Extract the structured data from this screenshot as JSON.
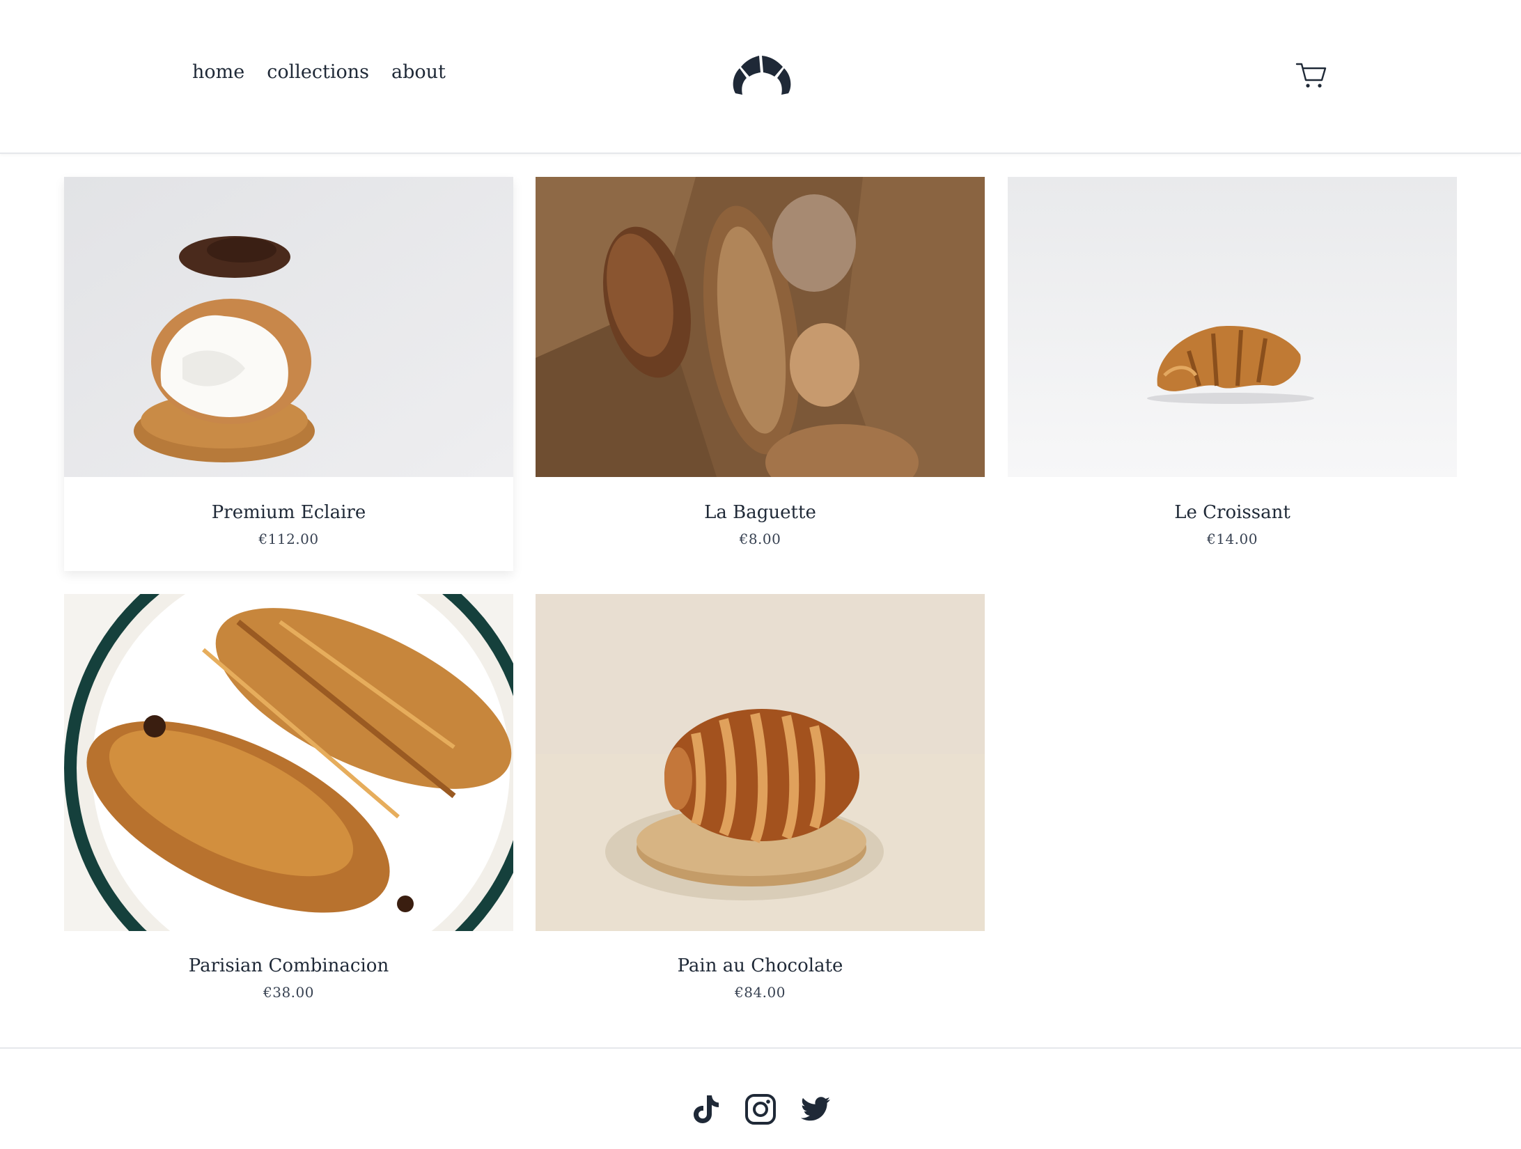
{
  "nav": {
    "home": "home",
    "collections": "collections",
    "about": "about"
  },
  "brand": {
    "logo_icon": "croissant-logo-icon",
    "cart_icon": "cart-icon"
  },
  "products": [
    {
      "name": "Premium Eclaire",
      "price": "€112.00"
    },
    {
      "name": "La Baguette",
      "price": "€8.00"
    },
    {
      "name": "Le Croissant",
      "price": "€14.00"
    },
    {
      "name": "Parisian Combinacion",
      "price": "€38.00"
    },
    {
      "name": "Pain au Chocolate",
      "price": "€84.00"
    }
  ],
  "footer": {
    "social_icons": [
      "tiktok-icon",
      "instagram-icon",
      "twitter-icon"
    ]
  },
  "colors": {
    "text": "#1f2937",
    "border": "#e5e7eb"
  }
}
